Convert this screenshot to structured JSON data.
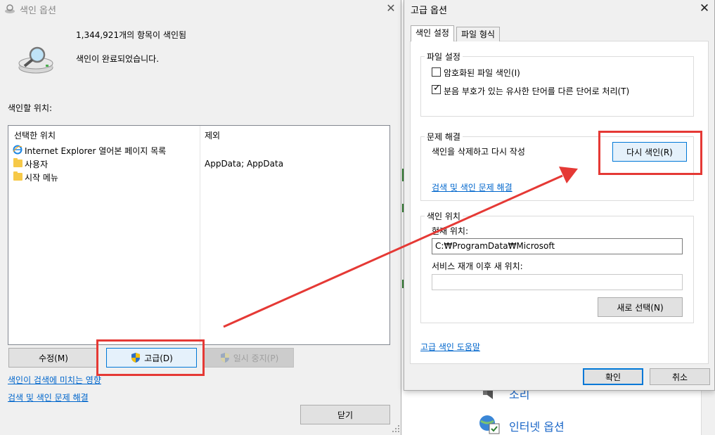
{
  "background": {
    "sound_label": "소리",
    "internet_options_label": "인터넷 옵션"
  },
  "left_dialog": {
    "title": "색인 옵션",
    "indexed_count": "1,344,921개의 항목이 색인됨",
    "status": "색인이 완료되었습니다.",
    "locations_label": "색인할 위치:",
    "table": {
      "headers": [
        "선택한 위치",
        "제외"
      ],
      "rows": [
        {
          "location": "Internet Explorer 열어본 페이지 목록",
          "exclude": ""
        },
        {
          "location": "사용자",
          "exclude": "AppData; AppData"
        },
        {
          "location": "시작 메뉴",
          "exclude": ""
        }
      ]
    },
    "buttons": {
      "modify": "수정(M)",
      "advanced": "고급(D)",
      "pause": "일시 중지(P)",
      "close": "닫기"
    },
    "links": {
      "impact": "색인이 검색에 미치는 영향",
      "troubleshoot": "검색 및 색인 문제 해결"
    }
  },
  "right_dialog": {
    "title": "고급 옵션",
    "tabs": [
      "색인 설정",
      "파일 형식"
    ],
    "file_settings": {
      "label": "파일 설정",
      "encrypted": {
        "label": "암호화된 파일 색인(I)",
        "checked": false
      },
      "diacritics": {
        "label": "분음 부호가 있는 유사한 단어를 다른 단어로 처리(T)",
        "checked": true
      }
    },
    "troubleshooting": {
      "label": "문제 해결",
      "rebuild_text": "색인을 삭제하고 다시 작성",
      "rebuild_button": "다시 색인(R)",
      "link": "검색 및 색인 문제 해결"
    },
    "index_location": {
      "label": "색인 위치",
      "current_label": "현재 위치:",
      "current_value": "C:₩ProgramData₩Microsoft",
      "new_label": "서비스 재개 이후 새 위치:",
      "new_value": "",
      "select_button": "새로 선택(N)"
    },
    "help_link": "고급 색인 도움말",
    "ok": "확인",
    "cancel": "취소"
  },
  "colors": {
    "highlight": "#e53935",
    "link": "#0066cc",
    "accent": "#0078d7"
  }
}
